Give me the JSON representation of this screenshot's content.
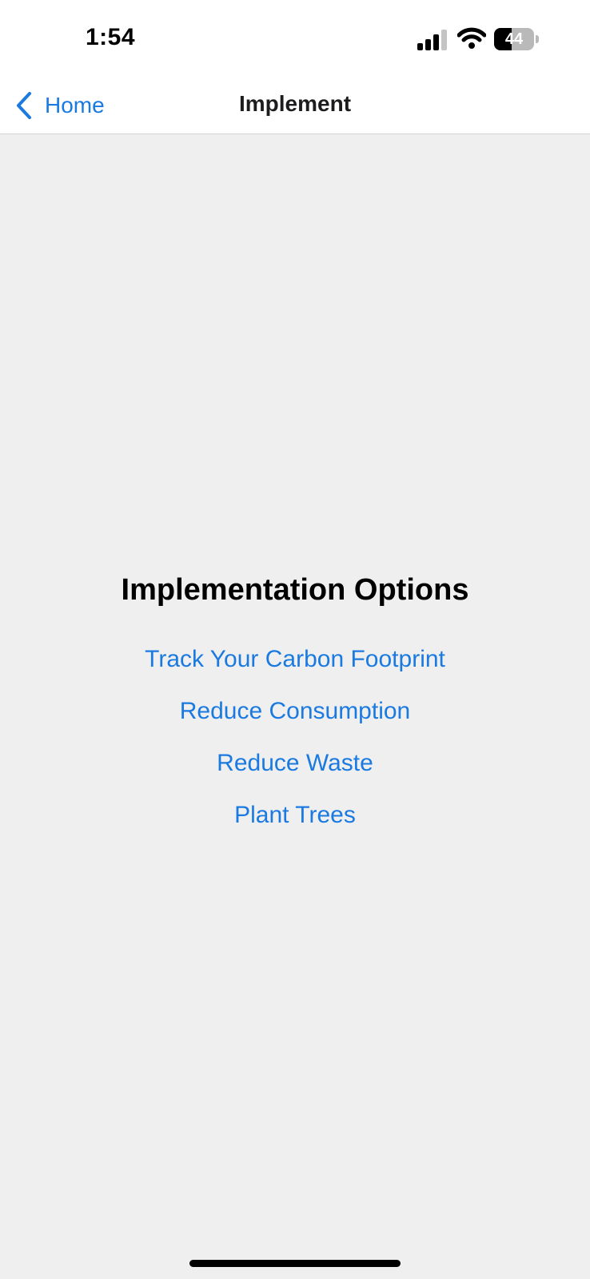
{
  "status_bar": {
    "time": "1:54",
    "battery_percent": 44,
    "battery_label": "44",
    "signal_bars_filled": 3,
    "signal_bars_total": 4,
    "icons": [
      "signal-icon",
      "wifi-icon",
      "battery-icon"
    ]
  },
  "nav": {
    "back_label": "Home",
    "back_icon": "chevron-left-icon",
    "title": "Implement"
  },
  "main": {
    "heading": "Implementation Options",
    "options": [
      {
        "label": "Track Your Carbon Footprint"
      },
      {
        "label": "Reduce Consumption"
      },
      {
        "label": "Reduce Waste"
      },
      {
        "label": "Plant Trees"
      }
    ]
  },
  "colors": {
    "accent": "#1a7ae0",
    "background": "#efefef",
    "header_background": "#ffffff"
  }
}
